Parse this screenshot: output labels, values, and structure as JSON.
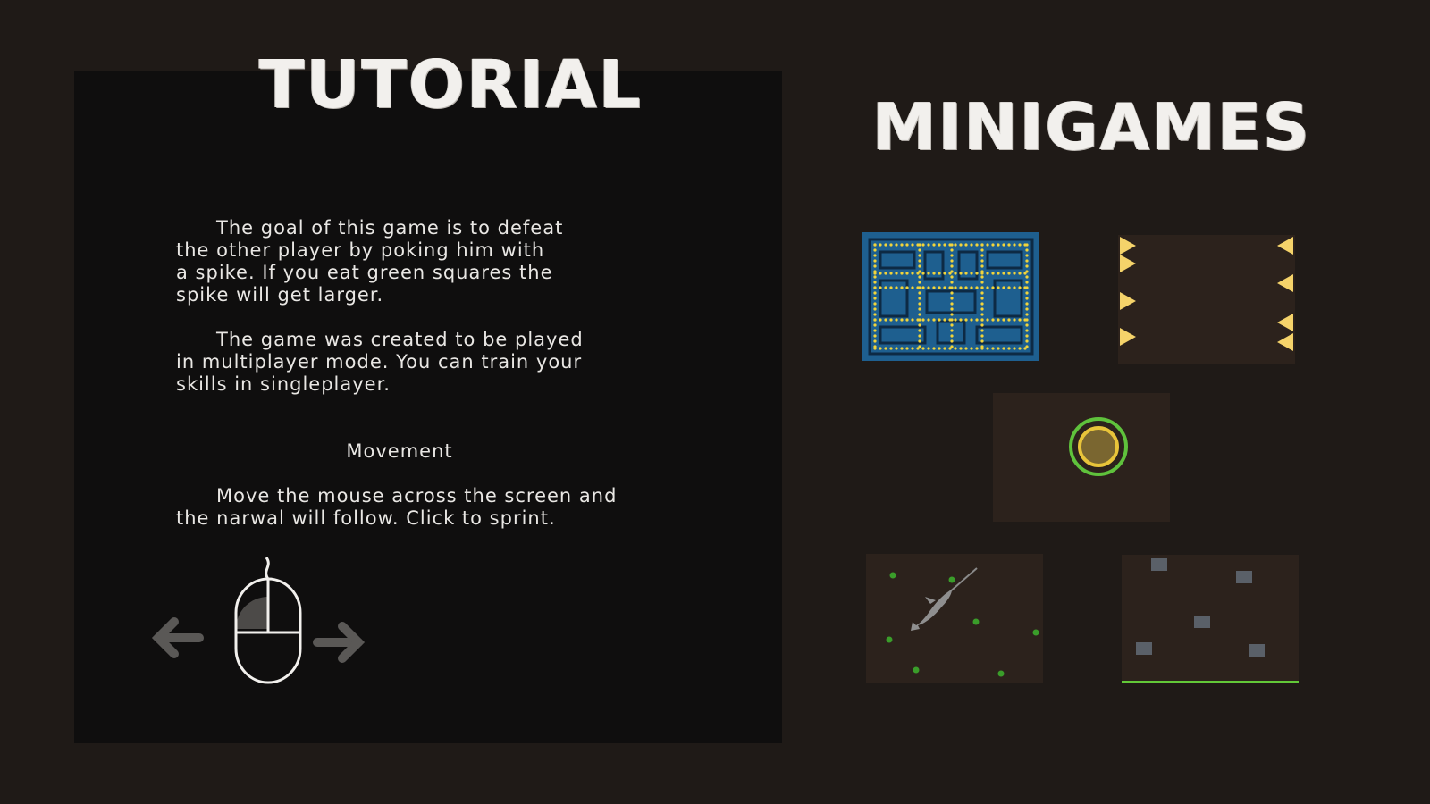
{
  "tutorial": {
    "title": "TUTORIAL",
    "paragraph1": [
      "The goal of this game is to defeat",
      "the other player by poking him with",
      "a spike. If you eat green squares the",
      "spike will get larger."
    ],
    "paragraph2": [
      "The game was created to be played",
      "in multiplayer mode. You can train your",
      "skills in singleplayer."
    ],
    "movement_heading": "Movement",
    "movement_text": [
      "Move the mouse across the screen and",
      "the narwal will follow. Click to sprint."
    ],
    "icons": {
      "left_arrow": "arrow-left-icon",
      "mouse": "mouse-icon",
      "right_arrow": "arrow-right-icon"
    }
  },
  "minigames": {
    "title": "MINIGAMES",
    "items": [
      {
        "name": "maze-game",
        "colors": {
          "background": "#1e5f8f",
          "dots": "#f2d43a"
        }
      },
      {
        "name": "spike-walls-game",
        "colors": {
          "background": "#2c221c",
          "spikes": "#f5d36a"
        }
      },
      {
        "name": "ring-target-game",
        "colors": {
          "background": "#2c221c",
          "ring": "#5fc23c",
          "inner": "#e8c43a"
        }
      },
      {
        "name": "narwhal-food-game",
        "colors": {
          "background": "#2c221c",
          "food": "#3a9d2a"
        }
      },
      {
        "name": "falling-blocks-game",
        "colors": {
          "background": "#2c221c",
          "blocks": "#5a6068",
          "floor": "#62c838"
        }
      }
    ]
  },
  "colors": {
    "page_background": "#1f1a17",
    "panel_background": "#0f0e0e",
    "text": "#e9e7e4"
  }
}
